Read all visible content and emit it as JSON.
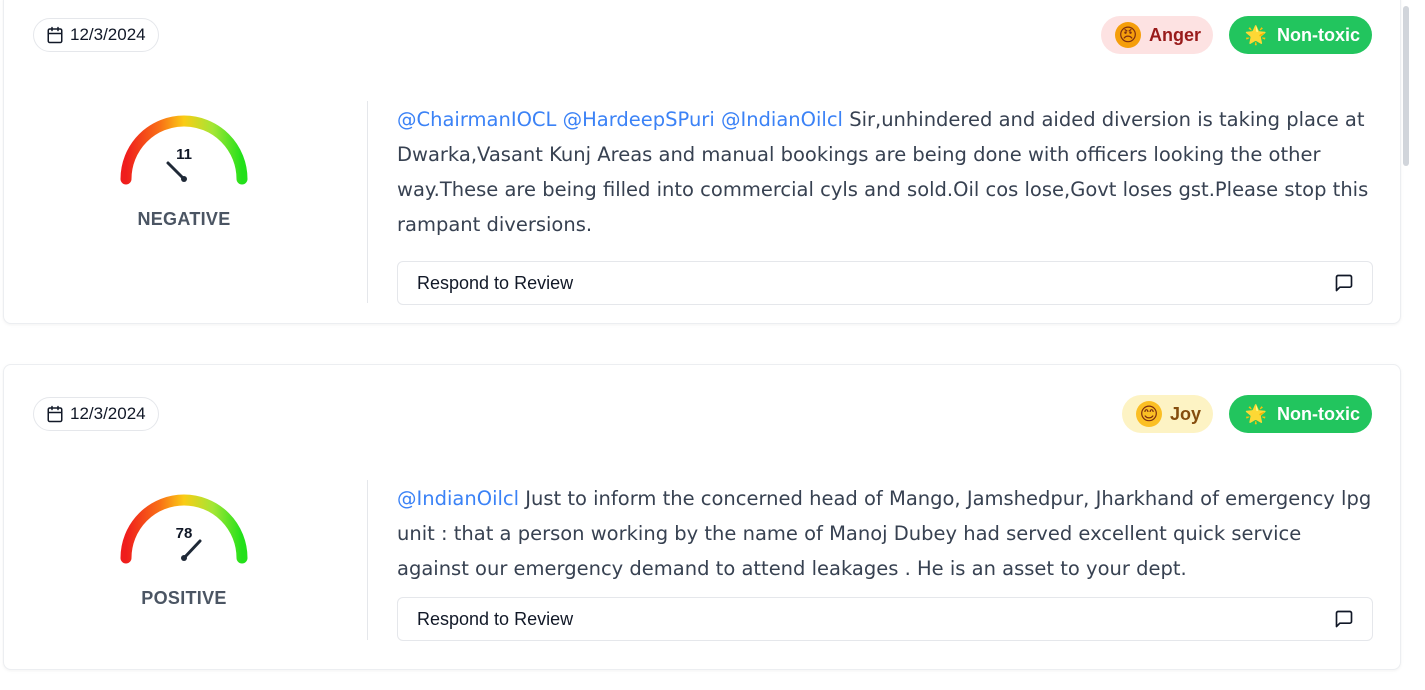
{
  "reviews": [
    {
      "date": "12/3/2024",
      "emotion": {
        "label": "Anger",
        "emoji": "😠"
      },
      "toxicity": {
        "label": "Non-toxic",
        "emoji": "🌟"
      },
      "score": "11",
      "sentiment": "NEGATIVE",
      "mentions": [
        "@ChairmanIOCL",
        "@HardeepSPuri",
        "@IndianOilcl"
      ],
      "text": "Sir,unhindered and aided diversion is taking place at Dwarka,Vasant Kunj Areas and manual bookings are being done with officers looking the other way.These are being filled into commercial cyls and sold.Oil cos lose,Govt loses gst.Please stop this rampant diversions.",
      "respond_label": "Respond to Review"
    },
    {
      "date": "12/3/2024",
      "emotion": {
        "label": "Joy",
        "emoji": "😊"
      },
      "toxicity": {
        "label": "Non-toxic",
        "emoji": "🌟"
      },
      "score": "78",
      "sentiment": "POSITIVE",
      "mentions": [
        "@IndianOilcl"
      ],
      "text": "Just to inform the concerned head of Mango, Jamshedpur, Jharkhand of emergency lpg unit : that a person working by the name of Manoj Dubey had served excellent quick service against our emergency demand to attend leakages . He is an asset to your dept.",
      "respond_label": "Respond to Review"
    }
  ]
}
